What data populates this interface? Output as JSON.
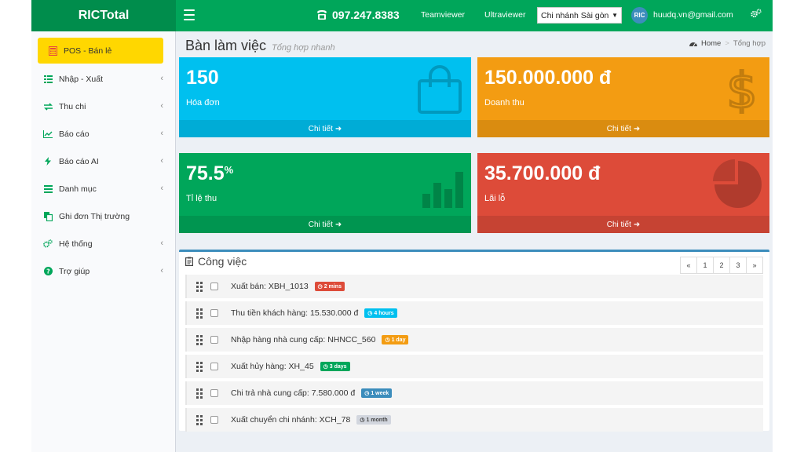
{
  "header": {
    "logo": "RICTotal",
    "phone": "097.247.8383",
    "links": [
      "Teamviewer",
      "Ultraviewer"
    ],
    "branch_selected": "Chi nhánh Sài gòn",
    "avatar_text": "RIC",
    "user_email": "huudq.vn@gmail.com",
    "brand_color": "#00a65a"
  },
  "sidebar": {
    "pos_label": "POS - Bán lẻ",
    "items": [
      {
        "label": "Nhập - Xuất",
        "icon": "table-icon",
        "has_chevron": true
      },
      {
        "label": "Thu chi",
        "icon": "exchange-icon",
        "has_chevron": true
      },
      {
        "label": "Báo cáo",
        "icon": "line-chart-icon",
        "has_chevron": true
      },
      {
        "label": "Báo cáo AI",
        "icon": "bolt-icon",
        "has_chevron": true
      },
      {
        "label": "Danh mục",
        "icon": "list-icon",
        "has_chevron": true
      },
      {
        "label": "Ghi đơn Thị trường",
        "icon": "copy-icon",
        "has_chevron": false
      },
      {
        "label": "Hệ thống",
        "icon": "gears-icon",
        "has_chevron": true
      },
      {
        "label": "Trợ giúp",
        "icon": "question-icon",
        "has_chevron": true
      }
    ]
  },
  "page": {
    "title": "Bàn làm việc",
    "subtitle": "Tổng hợp nhanh",
    "breadcrumb_home": "Home",
    "breadcrumb_current": "Tổng hợp"
  },
  "stats": [
    {
      "value": "150",
      "suffix": "",
      "label": "Hóa đơn",
      "link": "Chi tiết",
      "icon": "shopping-bag-icon",
      "color": "#00c0ef"
    },
    {
      "value": "150.000.000 đ",
      "suffix": "",
      "label": "Doanh thu",
      "link": "Chi tiết",
      "icon": "dollar-icon",
      "color": "#f39c12"
    },
    {
      "value": "75.5",
      "suffix": "%",
      "label": "Tỉ lệ thu",
      "link": "Chi tiết",
      "icon": "bar-chart-icon",
      "color": "#00a65a"
    },
    {
      "value": "35.700.000 đ",
      "suffix": "",
      "label": "Lãi lỗ",
      "link": "Chi tiết",
      "icon": "pie-chart-icon",
      "color": "#dd4b39"
    }
  ],
  "tasks": {
    "title": "Công việc",
    "pagination": [
      "«",
      "1",
      "2",
      "3",
      "»"
    ],
    "items": [
      {
        "text": "Xuất bán: XBH_1013",
        "badge": "2 mins",
        "color": "#dd4b39"
      },
      {
        "text": "Thu tiền khách hàng: 15.530.000 đ",
        "badge": "4 hours",
        "color": "#00c0ef"
      },
      {
        "text": "Nhập hàng nhà cung cấp: NHNCC_560",
        "badge": "1 day",
        "color": "#f39c12"
      },
      {
        "text": "Xuất hủy hàng: XH_45",
        "badge": "3 days",
        "color": "#00a65a"
      },
      {
        "text": "Chi trả nhà cung cấp: 7.580.000 đ",
        "badge": "1 week",
        "color": "#3c8dbc"
      },
      {
        "text": "Xuất chuyển chi nhánh: XCH_78",
        "badge": "1 month",
        "color": "#d2d6de"
      }
    ]
  }
}
